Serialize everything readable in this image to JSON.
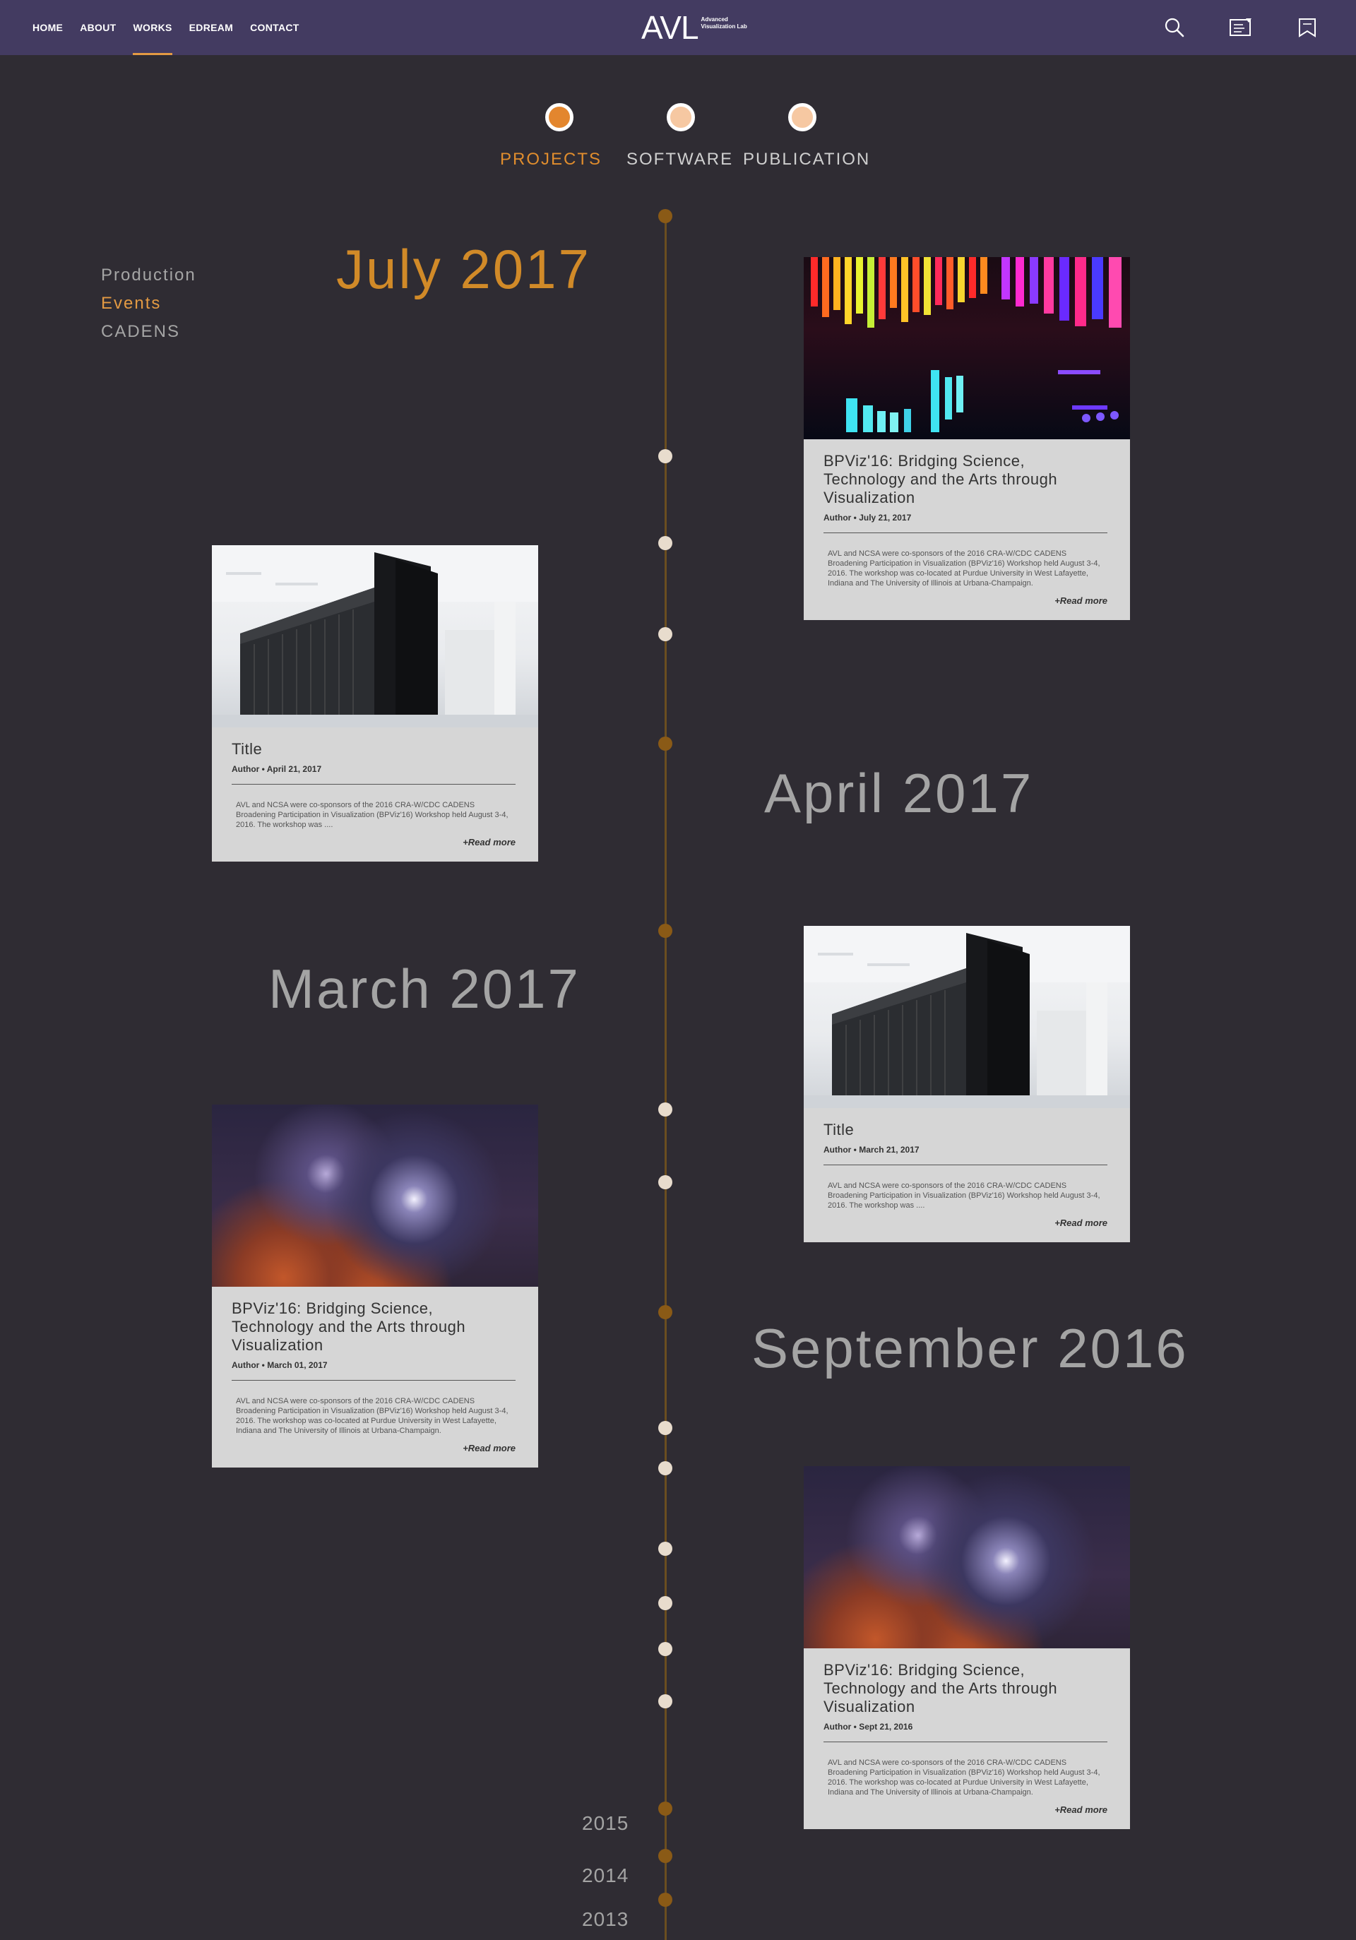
{
  "nav": {
    "links": [
      "HOME",
      "ABOUT",
      "WORKS",
      "EDREAM",
      "CONTACT"
    ],
    "active": "WORKS",
    "logo_mark": "AVL",
    "logo_sub_1": "Advanced",
    "logo_sub_2": "Visualization Lab",
    "icons": [
      "search-icon",
      "document-icon",
      "bookmark-icon"
    ]
  },
  "tabs": [
    {
      "label": "PROJECTS",
      "active": true
    },
    {
      "label": "SOFTWARE",
      "active": false
    },
    {
      "label": "PUBLICATION",
      "active": false
    }
  ],
  "filters": [
    {
      "label": "Production",
      "active": false
    },
    {
      "label": "Events",
      "active": true
    },
    {
      "label": "CADENS",
      "active": false
    }
  ],
  "months": {
    "july": "July 2017",
    "april": "April 2017",
    "march": "March 2017",
    "september": "September 2016"
  },
  "years": [
    "2015",
    "2014",
    "2013"
  ],
  "cards": [
    {
      "title": "BPViz'16: Bridging Science, Technology and the Arts through Visualization",
      "meta": "Author • July 21, 2017",
      "text": "AVL and NCSA were co-sponsors of the 2016 CRA-W/CDC CADENS Broadening Participation in Visualization (BPViz'16) Workshop held August 3-4, 2016. The workshop was co-located at Purdue University in West Lafayette, Indiana and The University of Illinois at Urbana-Champaign.",
      "more": "+Read more",
      "image": "colorful-light-bars"
    },
    {
      "title": "Title",
      "meta": "Author • April 21, 2017",
      "text": "AVL and NCSA were co-sponsors of the 2016 CRA-W/CDC CADENS Broadening Participation in Visualization (BPViz'16) Workshop held August 3-4, 2016. The workshop was ....",
      "more": "+Read more",
      "image": "server-room"
    },
    {
      "title": "Title",
      "meta": "Author • March 21, 2017",
      "text": "AVL and NCSA were co-sponsors of the 2016 CRA-W/CDC CADENS Broadening Participation in Visualization (BPViz'16) Workshop held August 3-4, 2016. The workshop was ....",
      "more": "+Read more",
      "image": "server-room"
    },
    {
      "title": "BPViz'16: Bridging Science, Technology and the Arts through Visualization",
      "meta": "Author • March 01, 2017",
      "text": "AVL and NCSA were co-sponsors of the 2016 CRA-W/CDC CADENS Broadening Participation in Visualization (BPViz'16) Workshop held August 3-4, 2016. The workshop was co-located at Purdue University in West Lafayette, Indiana and The University of Illinois at Urbana-Champaign.",
      "more": "+Read more",
      "image": "nebula"
    },
    {
      "title": "BPViz'16: Bridging Science, Technology and the Arts through Visualization",
      "meta": "Author • Sept 21, 2016",
      "text": "AVL and NCSA were co-sponsors of the 2016 CRA-W/CDC CADENS Broadening Participation in Visualization (BPViz'16) Workshop held August 3-4, 2016. The workshop was co-located at Purdue University in West Lafayette, Indiana and The University of Illinois at Urbana-Champaign.",
      "more": "+Read more",
      "image": "nebula"
    }
  ],
  "colors": {
    "nav_bg": "#433b61",
    "page_bg": "#2f2c33",
    "accent": "#e39a43",
    "timeline": "#6b4e20"
  }
}
